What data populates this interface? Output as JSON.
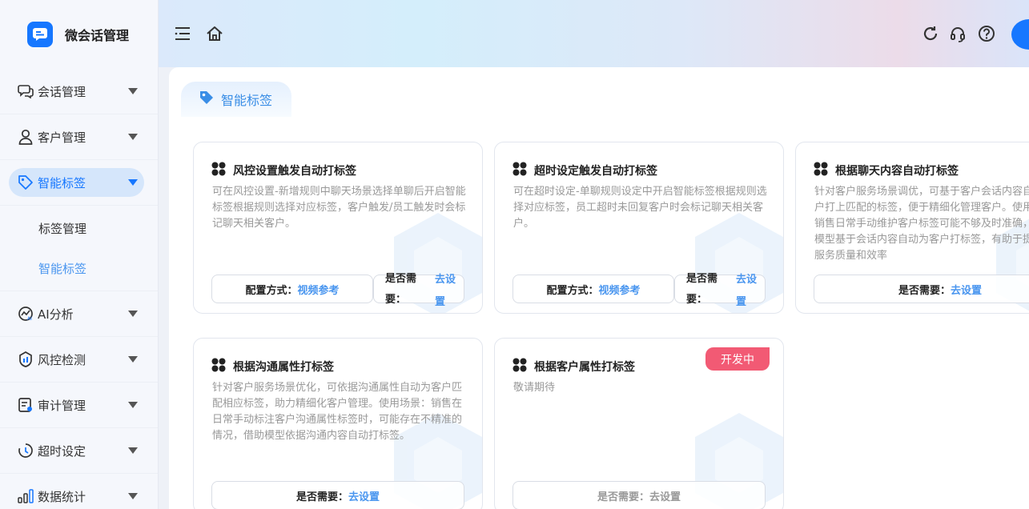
{
  "app": {
    "title": "微会话管理"
  },
  "sidebar": {
    "items": [
      {
        "label": "会话管理",
        "icon": "chat-bubbles-icon"
      },
      {
        "label": "客户管理",
        "icon": "user-icon"
      },
      {
        "label": "智能标签",
        "icon": "tag-icon",
        "active": true
      },
      {
        "label": "AI分析",
        "icon": "ai-analysis-icon"
      },
      {
        "label": "风控检测",
        "icon": "shield-icon"
      },
      {
        "label": "审计管理",
        "icon": "audit-icon"
      },
      {
        "label": "超时设定",
        "icon": "clock-icon"
      },
      {
        "label": "数据统计",
        "icon": "bar-chart-icon"
      }
    ],
    "sub_items": [
      {
        "label": "标签管理"
      },
      {
        "label": "智能标签",
        "active": true
      }
    ]
  },
  "page": {
    "tab_label": "智能标签"
  },
  "cards": [
    {
      "title": "风控设置触发自动打标签",
      "desc": "可在风控设置-新增规则中聊天场景选择单聊后开启智能标签根据规则选择对应标签，客户触发/员工触发时会标记聊天相关客户。",
      "cfg_label": "配置方式：",
      "cfg_link": "视频参考",
      "need_label": "是否需要：",
      "need_link": "去设置"
    },
    {
      "title": "超时设定触发自动打标签",
      "desc": "可在超时设定-单聊规则设定中开启智能标签根据规则选择对应标签，员工超时未回复客户时会标记聊天相关客户。",
      "cfg_label": "配置方式：",
      "cfg_link": "视频参考",
      "need_label": "是否需要：",
      "need_link": "去设置"
    },
    {
      "title": "根据聊天内容自动打标签",
      "desc": "针对客户服务场景调优，可基于客户会话内容自动为客户打上匹配的标签，便于精细化管理客户。使用场景：销售日常手动维护客户标签可能不够及时准确，可通过模型基于会话内容自动为客户打标签，有助于提升客户服务质量和效率",
      "need_label": "是否需要：",
      "need_link": "去设置"
    },
    {
      "title": "根据沟通属性打标签",
      "desc": "针对客户服务场景优化，可依据沟通属性自动为客户匹配相应标签，助力精细化客户管理。使用场景：销售在日常手动标注客户沟通属性标签时，可能存在不精准的情况，借助模型依据沟通内容自动打标签。",
      "need_label": "是否需要：",
      "need_link": "去设置"
    },
    {
      "title": "根据客户属性打标签",
      "desc": "敬请期待",
      "badge": "开发中",
      "need_label": "是否需要：",
      "need_link": "去设置"
    }
  ]
}
